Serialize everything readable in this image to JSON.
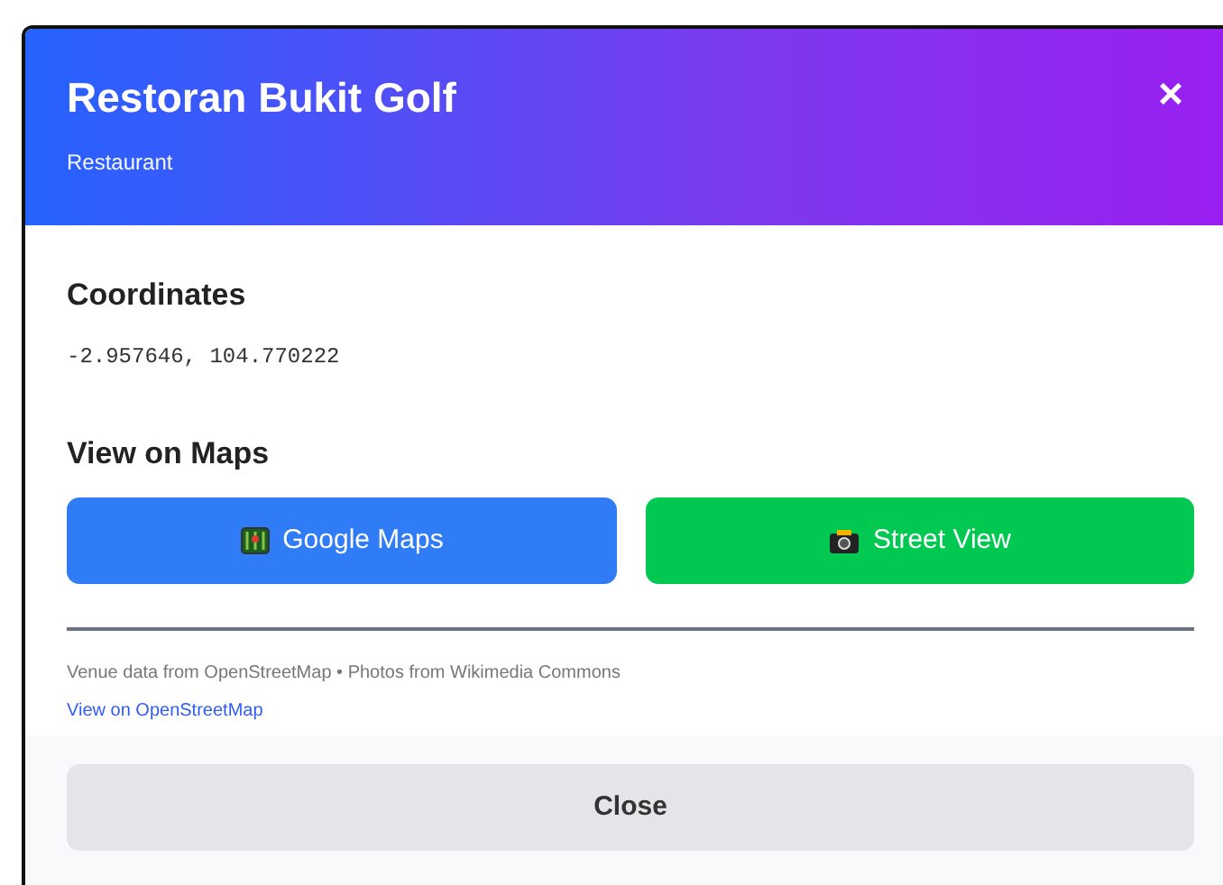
{
  "modal": {
    "title": "Restoran Bukit Golf",
    "subtitle": "Restaurant",
    "close_symbol": "×"
  },
  "coordinates": {
    "heading": "Coordinates",
    "value": "-2.957646, 104.770222"
  },
  "maps": {
    "heading": "View on Maps",
    "buttons": [
      {
        "label": "Google Maps",
        "kind": "map"
      },
      {
        "label": "Street View",
        "kind": "camera"
      }
    ]
  },
  "attribution": {
    "text": "Venue data from OpenStreetMap • Photos from Wikimedia Commons",
    "link": "View on OpenStreetMap"
  },
  "footer": {
    "button": "Close"
  }
}
